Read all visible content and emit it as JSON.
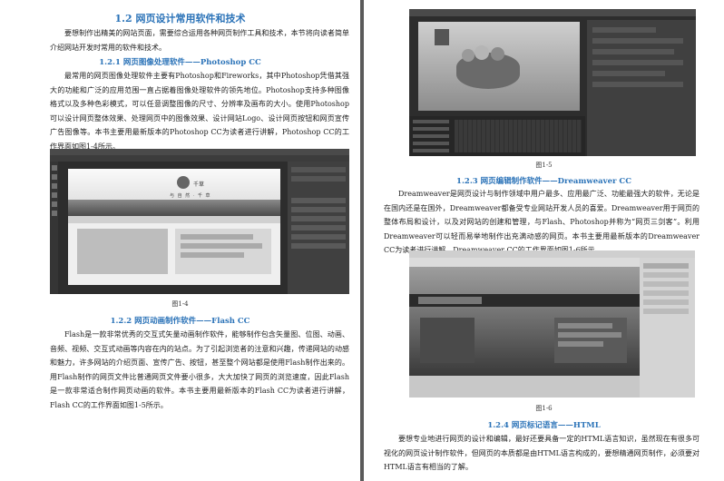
{
  "left": {
    "section_title": "1.2 网页设计常用软件和技术",
    "intro": "要想制作出精美的网站页面，需要综合运用各种网页制作工具和技术，本节将向读者简单介绍网站开发时常用的软件和技术。",
    "sub1_title": "1.2.1 网页图像处理软件——Photoshop CC",
    "sub1_text": "最常用的网页图像处理软件主要有Photoshop和Fireworks，其中Photoshop凭借其强大的功能和广泛的应用范围一直占据着图像处理软件的领先地位。Photoshop支持多种图像格式以及多种色彩模式，可以任意调整图像的尺寸、分辨率及画布的大小。使用Photoshop可以设计网页整体效果、处理网页中的图像效果、设计网站Logo、设计网页按钮和网页宣传广告图像等。本书主要用最新版本的Photoshop CC为读者进行讲解，Photoshop CC的工作界面如图1-4所示。",
    "fig1_caption": "图1-4",
    "sub2_title": "1.2.2 网页动画制作软件——Flash CC",
    "sub2_text": "Flash是一款非常优秀的交互式矢量动画制作软件，能够制作包含矢量图、位图、动画、音频、视频、交互式动画等内容在内的站点。为了引起浏览者的注意和兴趣，传递网站的动感和魅力，许多网站的介绍页面、宣传广告、按钮，甚至整个网站都是使用Flash制作出来的。用Flash制作的网页文件比普通网页文件要小很多，大大加快了网页的浏览速度，因此Flash是一款非常适合制作网页动画的软件。本书主要用最新版本的Flash CC为读者进行讲解，Flash CC的工作界面如图1-5所示。",
    "shot_logo_text": "千草",
    "shot_slogan": "与 自 然 · 千 草"
  },
  "right": {
    "fig2_caption": "图1-5",
    "sub3_title": "1.2.3 网页编辑制作软件——Dreamweaver CC",
    "sub3_text": "Dreamweaver是网页设计与制作领域中用户最多、应用最广泛、功能最强大的软件，无论是在国内还是在国外，Dreamweaver都备受专业网站开发人员的喜爱。Dreamweaver用于网页的整体布局和设计，以及对网站的创建和管理，与Flash、Photoshop并称为“网页三剑客”。利用Dreamweaver可以轻而易举地制作出充满动感的网页。本书主要用最新版本的Dreamweaver CC为读者进行讲解，Dreamweaver CC的工作界面如图1-6所示。",
    "fig3_caption": "图1-6",
    "sub4_title": "1.2.4 网页标记语言——HTML",
    "sub4_text": "要想专业地进行网页的设计和编辑，最好还要具备一定的HTML语言知识，虽然现在有很多可视化的网页设计制作软件，但网页的本质都是由HTML语言构成的，要想精通网页制作，必须要对HTML语言有相当的了解。"
  }
}
